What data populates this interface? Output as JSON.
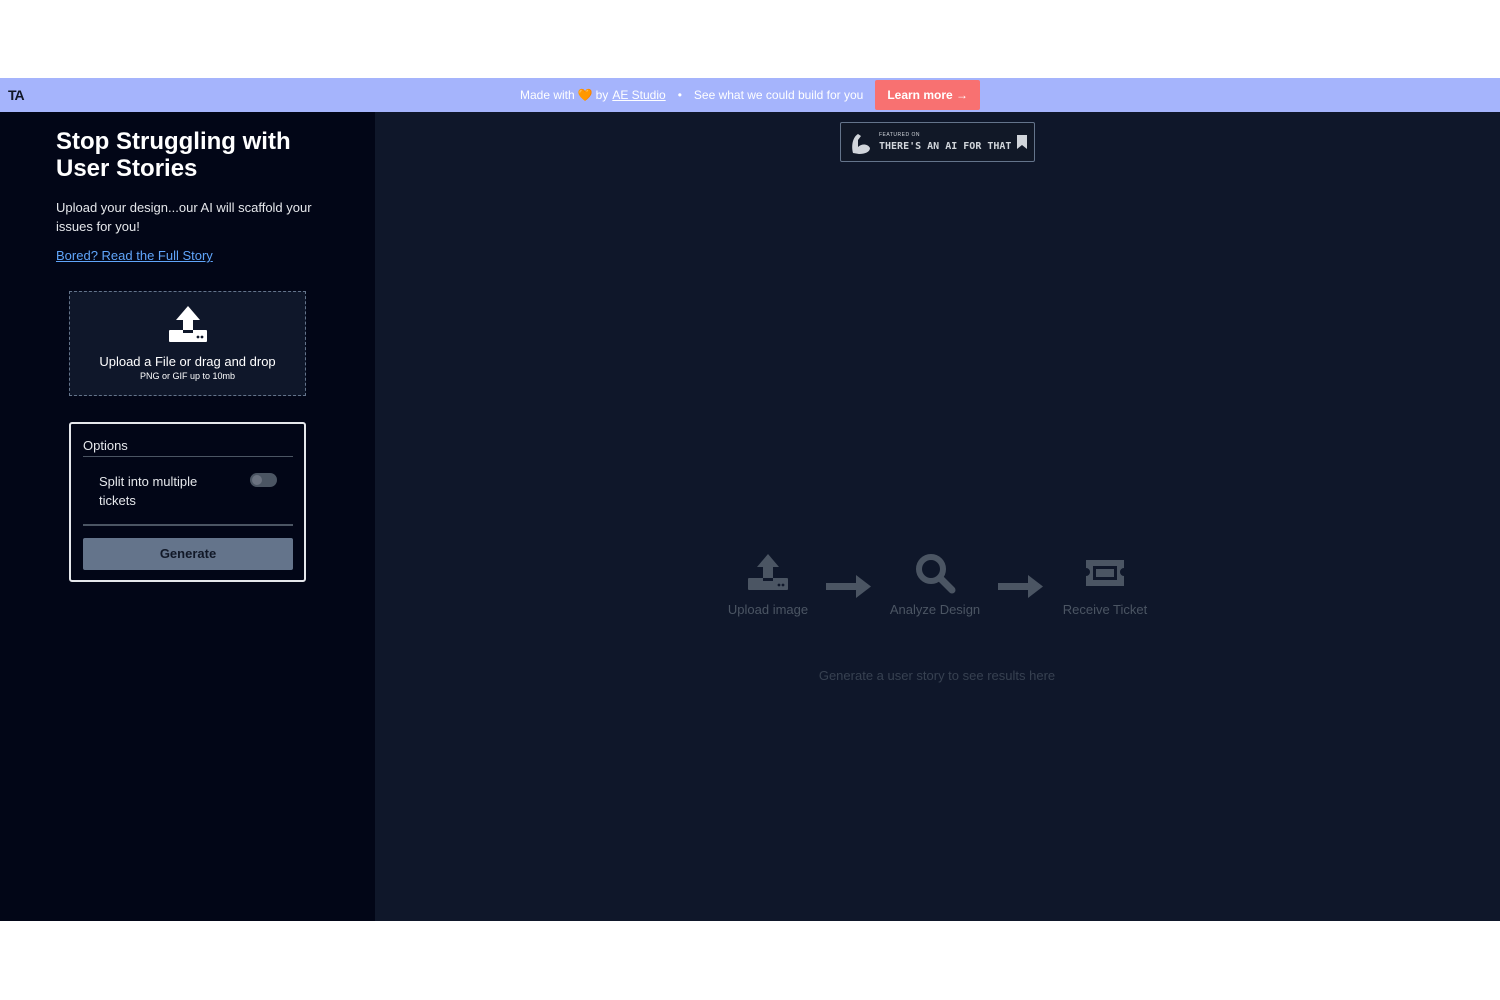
{
  "banner": {
    "logo": "TA",
    "made_with": "Made with",
    "heart": "🧡",
    "by": "by",
    "studio_link": "AE Studio",
    "dot": "•",
    "tagline": "See what we could build for you",
    "cta": "Learn more →"
  },
  "sidebar": {
    "title": "Stop Struggling with User Stories",
    "subtitle": "Upload your design...our AI will scaffold your issues for you!",
    "read_link": "Bored? Read the Full Story",
    "dropzone": {
      "main": "Upload a File or drag and drop",
      "hint": "PNG or GIF up to 10mb",
      "icon": "upload-icon"
    },
    "options": {
      "label": "Options",
      "split_label": "Split into multiple tickets",
      "split_enabled": false,
      "generate_label": "Generate"
    }
  },
  "badge": {
    "featured": "FEATURED ON",
    "name": "THERE'S AN AI FOR THAT"
  },
  "steps": [
    {
      "label": "Upload image",
      "icon": "upload-icon"
    },
    {
      "label": "Analyze Design",
      "icon": "magnifier-icon"
    },
    {
      "label": "Receive Ticket",
      "icon": "ticket-icon"
    }
  ],
  "results_hint": "Generate a user story to see results here",
  "colors": {
    "banner_bg": "#a5b4fc",
    "cta_bg": "#f87171",
    "sidebar_bg": "#020617",
    "main_bg": "#0f172a",
    "link": "#60a5fa"
  }
}
